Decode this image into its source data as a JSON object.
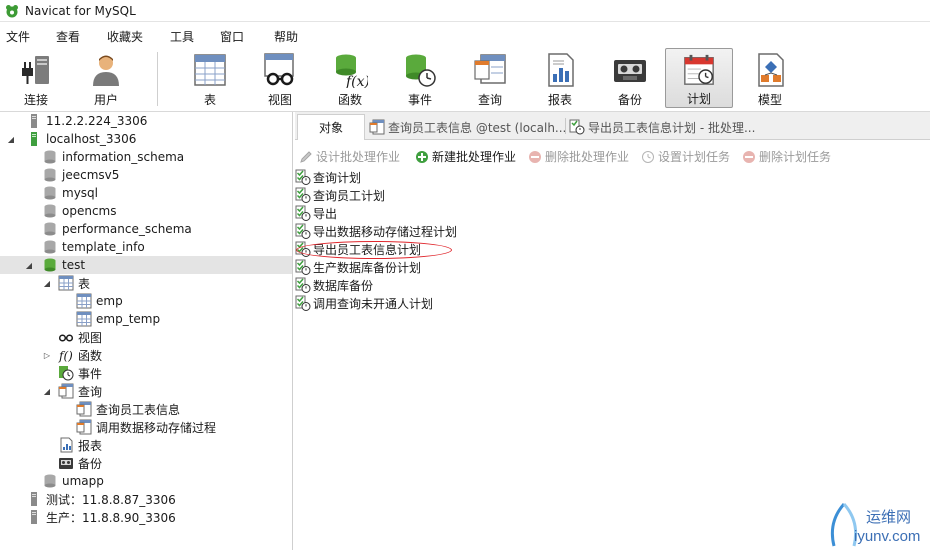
{
  "window": {
    "title": "Navicat for MySQL"
  },
  "menu": [
    "文件",
    "查看",
    "收藏夹",
    "工具",
    "窗口",
    "帮助"
  ],
  "toolbar": {
    "buttons": [
      {
        "label": "连接",
        "icon": "plug-icon"
      },
      {
        "label": "用户",
        "icon": "user-icon"
      },
      {
        "label": "表",
        "icon": "table-icon"
      },
      {
        "label": "视图",
        "icon": "view-glasses-icon"
      },
      {
        "label": "函数",
        "icon": "function-icon"
      },
      {
        "label": "事件",
        "icon": "event-clock-icon"
      },
      {
        "label": "查询",
        "icon": "query-icon"
      },
      {
        "label": "报表",
        "icon": "report-icon"
      },
      {
        "label": "备份",
        "icon": "backup-tape-icon"
      },
      {
        "label": "计划",
        "icon": "schedule-calendar-icon",
        "active": true
      },
      {
        "label": "模型",
        "icon": "model-icon"
      }
    ]
  },
  "tree": [
    {
      "label": "11.2.2.224_3306"
    },
    {
      "label": "localhost_3306"
    },
    {
      "label": "information_schema"
    },
    {
      "label": "jeecmsv5"
    },
    {
      "label": "mysql"
    },
    {
      "label": "opencms"
    },
    {
      "label": "performance_schema"
    },
    {
      "label": "template_info"
    },
    {
      "label": "test"
    },
    {
      "label": "表"
    },
    {
      "label": "emp"
    },
    {
      "label": "emp_temp"
    },
    {
      "label": "视图"
    },
    {
      "label": "函数"
    },
    {
      "label": "事件"
    },
    {
      "label": "查询"
    },
    {
      "label": "查询员工表信息"
    },
    {
      "label": "调用数据移动存储过程"
    },
    {
      "label": "报表"
    },
    {
      "label": "备份"
    },
    {
      "label": "umapp"
    },
    {
      "label": "测试：11.8.8.87_3306"
    },
    {
      "label": "生产：11.8.8.90_3306"
    }
  ],
  "tabs": [
    {
      "label": "对象"
    },
    {
      "label": "查询员工表信息 @test (localh..."
    },
    {
      "label": "导出员工表信息计划 - 批处理..."
    }
  ],
  "actions": [
    {
      "label": "设计批处理作业"
    },
    {
      "label": "新建批处理作业"
    },
    {
      "label": "删除批处理作业"
    },
    {
      "label": "设置计划任务"
    },
    {
      "label": "删除计划任务"
    }
  ],
  "objects": [
    "查询计划",
    "查询员工计划",
    "导出",
    "导出数据移动存储过程计划",
    "导出员工表信息计划",
    "生产数据库备份计划",
    "数据库备份",
    "调用查询未开通人计划"
  ],
  "watermark": {
    "cn": "运维网",
    "en": "iyunv.com"
  },
  "colors": {
    "accent_green": "#3f9f3f",
    "highlight": "#e0282e",
    "selection": "#e4e4e4"
  }
}
